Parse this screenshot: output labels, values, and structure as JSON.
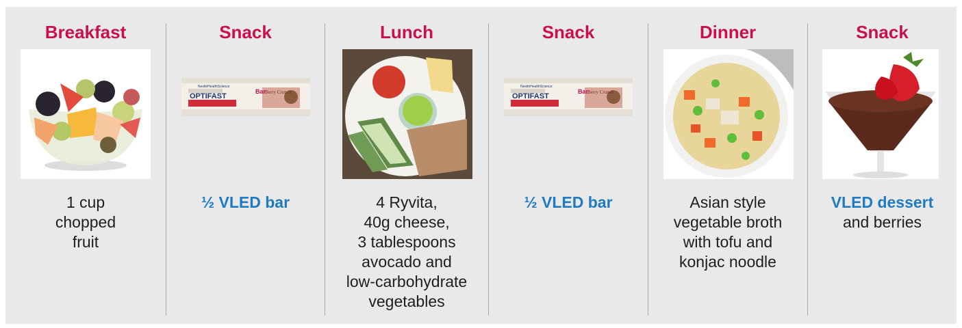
{
  "meals": [
    {
      "title": "Breakfast",
      "caption_lines": [
        "1 cup",
        "chopped",
        "fruit"
      ],
      "highlight": "",
      "image": "fruit-bowl"
    },
    {
      "title": "Snack",
      "caption_lines": [],
      "highlight": "½ VLED bar",
      "image": "optifast-bar"
    },
    {
      "title": "Lunch",
      "caption_lines": [
        "4 Ryvita,",
        "40g cheese,",
        "3 tablespoons",
        "avocado and",
        "low-carbohydrate",
        "vegetables"
      ],
      "highlight": "",
      "image": "lunch-plate"
    },
    {
      "title": "Snack",
      "caption_lines": [],
      "highlight": "½ VLED bar",
      "image": "optifast-bar"
    },
    {
      "title": "Dinner",
      "caption_lines": [
        "Asian style",
        "vegetable broth",
        "with tofu and",
        "konjac noodle"
      ],
      "highlight": "",
      "image": "vegetable-broth"
    },
    {
      "title": "Snack",
      "caption_lines": [
        "and berries"
      ],
      "highlight": "VLED dessert",
      "image": "chocolate-dessert"
    }
  ],
  "bar_packaging": {
    "brand": "OPTIFAST",
    "maker": "NestléHealthScience",
    "flavour": "Berry Crunch",
    "name_fragment": "Bar"
  },
  "colors": {
    "title": "#c8104e",
    "highlight": "#1f7bbf",
    "panel": "#e9e9ea",
    "divider": "#a9a9ac"
  }
}
